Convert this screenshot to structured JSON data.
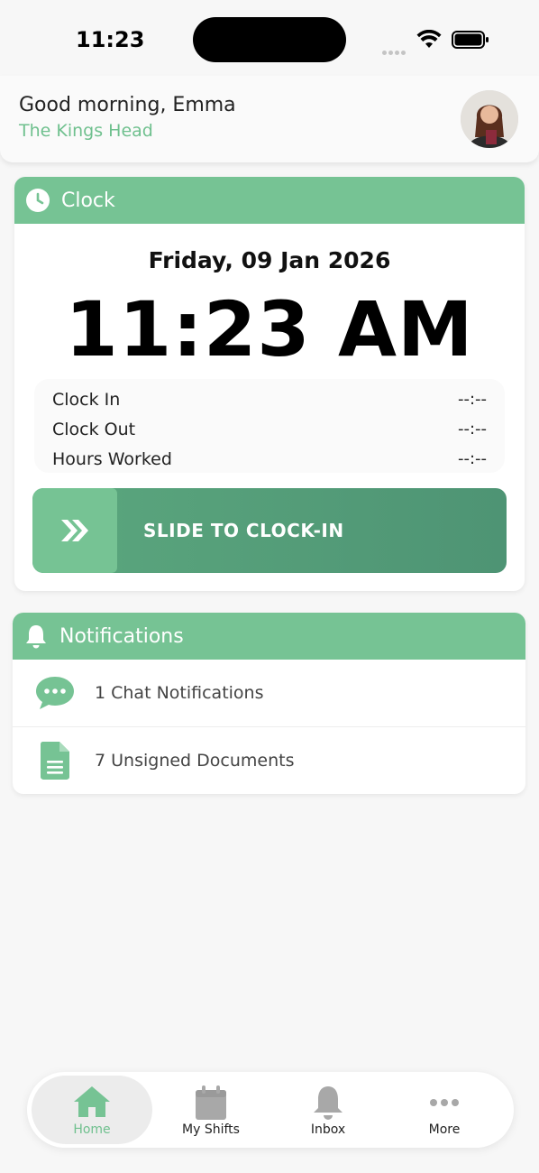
{
  "status_bar": {
    "time": "11:23"
  },
  "header": {
    "greeting": "Good morning, Emma",
    "venue": "The Kings Head"
  },
  "clock": {
    "title": "Clock",
    "date": "Friday, 09 Jan 2026",
    "time": "11:23 AM",
    "rows": [
      {
        "label": "Clock In",
        "value": "--:--"
      },
      {
        "label": "Clock Out",
        "value": "--:--"
      },
      {
        "label": "Hours Worked",
        "value": "--:--"
      }
    ],
    "slider_label": "SLIDE TO CLOCK-IN"
  },
  "notifications": {
    "title": "Notifications",
    "items": [
      {
        "text": "1 Chat Notifications",
        "icon": "chat-icon"
      },
      {
        "text": "7 Unsigned Documents",
        "icon": "document-icon"
      }
    ]
  },
  "tabs": [
    {
      "label": "Home",
      "icon": "home-icon",
      "active": true
    },
    {
      "label": "My Shifts",
      "icon": "calendar-icon",
      "active": false
    },
    {
      "label": "Inbox",
      "icon": "bell-icon",
      "active": false
    },
    {
      "label": "More",
      "icon": "more-icon",
      "active": false
    }
  ],
  "colors": {
    "accent": "#76c394",
    "slider": "#4e9474",
    "active_tab_text": "#6fc08e"
  }
}
